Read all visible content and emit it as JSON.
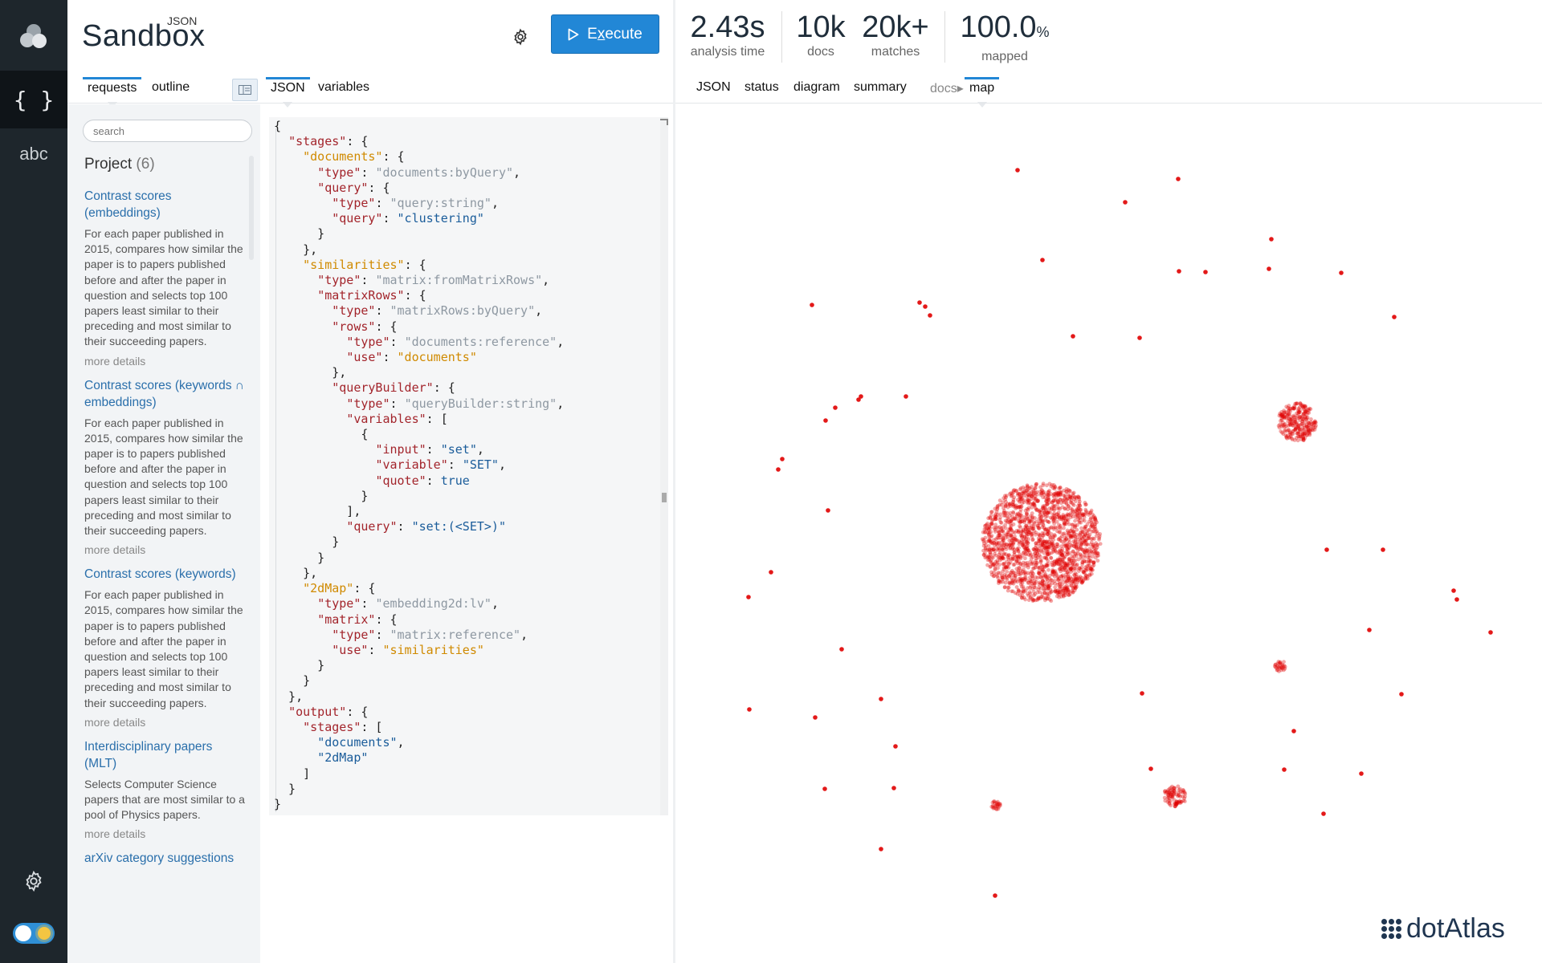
{
  "rail": {
    "icons": [
      "app-logo-icon",
      "json-braces-icon",
      "abc-text-icon",
      "settings-gear-icon",
      "theme-toggle"
    ],
    "json_label": "{ }",
    "abc_label": "abc"
  },
  "header": {
    "brand_super": "JSON",
    "brand_name": "Sandbox",
    "execute_label_pre": "E",
    "execute_label_u": "x",
    "execute_label_post": "ecute"
  },
  "stats": [
    {
      "value": "2.43s",
      "label": "analysis time"
    },
    {
      "value": "10k",
      "label": "docs"
    },
    {
      "value": "20k+",
      "label": "matches"
    },
    {
      "value": "100.0",
      "unit": "%",
      "label": "mapped"
    }
  ],
  "left_tabs": [
    {
      "label": "requests",
      "active": true
    },
    {
      "label": "outline",
      "active": false
    }
  ],
  "editor_tabs": [
    {
      "label": "JSON",
      "active": true
    },
    {
      "label": "variables",
      "active": false
    }
  ],
  "result_tabs": [
    {
      "label": "JSON",
      "active": false
    },
    {
      "label": "status",
      "active": false
    },
    {
      "label": "diagram",
      "active": false
    },
    {
      "label": "summary",
      "active": false
    },
    {
      "label": "docs▸",
      "active": false
    },
    {
      "label": "map",
      "active": true
    }
  ],
  "sidebar": {
    "search_placeholder": "search",
    "project_title": "Project",
    "project_count": "(6)",
    "requests": [
      {
        "title": "Contrast scores (embeddings)",
        "desc": "For each paper published in 2015, compares how similar the paper is to papers published before and after the paper in question and selects top 100 papers least similar to their preceding and most similar to their succeeding papers.",
        "more": "more details"
      },
      {
        "title": "Contrast scores (keywords ∩ embeddings)",
        "desc": "For each paper published in 2015, compares how similar the paper is to papers published before and after the paper in question and selects top 100 papers least similar to their preceding and most similar to their succeeding papers.",
        "more": "more details"
      },
      {
        "title": "Contrast scores (keywords)",
        "desc": "For each paper published in 2015, compares how similar the paper is to papers published before and after the paper in question and selects top 100 papers least similar to their preceding and most similar to their succeeding papers.",
        "more": "more details"
      },
      {
        "title": "Interdisciplinary papers (MLT)",
        "desc": "Selects Computer Science papers that are most similar to a pool of Physics papers.",
        "more": "more details"
      },
      {
        "title": "arXiv category suggestions",
        "desc": "",
        "more": ""
      }
    ]
  },
  "editor": {
    "lines": [
      [
        [
          "p",
          "{"
        ]
      ],
      [
        [
          "p",
          "  "
        ],
        [
          "k",
          "\"stages\""
        ],
        [
          "p",
          ": {"
        ]
      ],
      [
        [
          "p",
          "    "
        ],
        [
          "u",
          "\"documents\""
        ],
        [
          "p",
          ": {"
        ]
      ],
      [
        [
          "p",
          "      "
        ],
        [
          "k",
          "\"type\""
        ],
        [
          "p",
          ": "
        ],
        [
          "t",
          "\"documents:byQuery\""
        ],
        [
          "p",
          ","
        ]
      ],
      [
        [
          "p",
          "      "
        ],
        [
          "k",
          "\"query\""
        ],
        [
          "p",
          ": {"
        ]
      ],
      [
        [
          "p",
          "        "
        ],
        [
          "k",
          "\"type\""
        ],
        [
          "p",
          ": "
        ],
        [
          "t",
          "\"query:string\""
        ],
        [
          "p",
          ","
        ]
      ],
      [
        [
          "p",
          "        "
        ],
        [
          "k",
          "\"query\""
        ],
        [
          "p",
          ": "
        ],
        [
          "s",
          "\"clustering\""
        ]
      ],
      [
        [
          "p",
          "      }"
        ]
      ],
      [
        [
          "p",
          "    },"
        ]
      ],
      [
        [
          "p",
          "    "
        ],
        [
          "u",
          "\"similarities\""
        ],
        [
          "p",
          ": {"
        ]
      ],
      [
        [
          "p",
          "      "
        ],
        [
          "k",
          "\"type\""
        ],
        [
          "p",
          ": "
        ],
        [
          "t",
          "\"matrix:fromMatrixRows\""
        ],
        [
          "p",
          ","
        ]
      ],
      [
        [
          "p",
          "      "
        ],
        [
          "k",
          "\"matrixRows\""
        ],
        [
          "p",
          ": {"
        ]
      ],
      [
        [
          "p",
          "        "
        ],
        [
          "k",
          "\"type\""
        ],
        [
          "p",
          ": "
        ],
        [
          "t",
          "\"matrixRows:byQuery\""
        ],
        [
          "p",
          ","
        ]
      ],
      [
        [
          "p",
          "        "
        ],
        [
          "k",
          "\"rows\""
        ],
        [
          "p",
          ": {"
        ]
      ],
      [
        [
          "p",
          "          "
        ],
        [
          "k",
          "\"type\""
        ],
        [
          "p",
          ": "
        ],
        [
          "t",
          "\"documents:reference\""
        ],
        [
          "p",
          ","
        ]
      ],
      [
        [
          "p",
          "          "
        ],
        [
          "k",
          "\"use\""
        ],
        [
          "p",
          ": "
        ],
        [
          "u",
          "\"documents\""
        ]
      ],
      [
        [
          "p",
          "        },"
        ]
      ],
      [
        [
          "p",
          "        "
        ],
        [
          "k",
          "\"queryBuilder\""
        ],
        [
          "p",
          ": {"
        ]
      ],
      [
        [
          "p",
          "          "
        ],
        [
          "k",
          "\"type\""
        ],
        [
          "p",
          ": "
        ],
        [
          "t",
          "\"queryBuilder:string\""
        ],
        [
          "p",
          ","
        ]
      ],
      [
        [
          "p",
          "          "
        ],
        [
          "k",
          "\"variables\""
        ],
        [
          "p",
          ": ["
        ]
      ],
      [
        [
          "p",
          "            {"
        ]
      ],
      [
        [
          "p",
          "              "
        ],
        [
          "k",
          "\"input\""
        ],
        [
          "p",
          ": "
        ],
        [
          "s",
          "\"set\""
        ],
        [
          "p",
          ","
        ]
      ],
      [
        [
          "p",
          "              "
        ],
        [
          "k",
          "\"variable\""
        ],
        [
          "p",
          ": "
        ],
        [
          "s",
          "\"SET\""
        ],
        [
          "p",
          ","
        ]
      ],
      [
        [
          "p",
          "              "
        ],
        [
          "k",
          "\"quote\""
        ],
        [
          "p",
          ": "
        ],
        [
          "s",
          "true"
        ]
      ],
      [
        [
          "p",
          "            }"
        ]
      ],
      [
        [
          "p",
          "          ],"
        ]
      ],
      [
        [
          "p",
          "          "
        ],
        [
          "k",
          "\"query\""
        ],
        [
          "p",
          ": "
        ],
        [
          "s",
          "\"set:(<SET>)\""
        ]
      ],
      [
        [
          "p",
          "        }"
        ]
      ],
      [
        [
          "p",
          "      }"
        ]
      ],
      [
        [
          "p",
          "    },"
        ]
      ],
      [
        [
          "p",
          "    "
        ],
        [
          "u",
          "\"2dMap\""
        ],
        [
          "p",
          ": {"
        ]
      ],
      [
        [
          "p",
          "      "
        ],
        [
          "k",
          "\"type\""
        ],
        [
          "p",
          ": "
        ],
        [
          "t",
          "\"embedding2d:lv\""
        ],
        [
          "p",
          ","
        ]
      ],
      [
        [
          "p",
          "      "
        ],
        [
          "k",
          "\"matrix\""
        ],
        [
          "p",
          ": {"
        ]
      ],
      [
        [
          "p",
          "        "
        ],
        [
          "k",
          "\"type\""
        ],
        [
          "p",
          ": "
        ],
        [
          "t",
          "\"matrix:reference\""
        ],
        [
          "p",
          ","
        ]
      ],
      [
        [
          "p",
          "        "
        ],
        [
          "k",
          "\"use\""
        ],
        [
          "p",
          ": "
        ],
        [
          "u",
          "\"similarities\""
        ]
      ],
      [
        [
          "p",
          "      }"
        ]
      ],
      [
        [
          "p",
          "    }"
        ]
      ],
      [
        [
          "p",
          "  },"
        ]
      ],
      [
        [
          "p",
          "  "
        ],
        [
          "k",
          "\"output\""
        ],
        [
          "p",
          ": {"
        ]
      ],
      [
        [
          "p",
          "    "
        ],
        [
          "k",
          "\"stages\""
        ],
        [
          "p",
          ": ["
        ]
      ],
      [
        [
          "p",
          "      "
        ],
        [
          "s",
          "\"documents\""
        ],
        [
          "p",
          ","
        ]
      ],
      [
        [
          "p",
          "      "
        ],
        [
          "s",
          "\"2dMap\""
        ]
      ],
      [
        [
          "p",
          "    ]"
        ]
      ],
      [
        [
          "p",
          "  }"
        ]
      ],
      [
        [
          "p",
          "}"
        ]
      ]
    ]
  },
  "map": {
    "dot_color": "#e00000",
    "logo_text": "dotAtlas"
  },
  "colors": {
    "accent": "#2287d6",
    "rail_bg": "#1e262c",
    "link": "#2a6fab"
  }
}
